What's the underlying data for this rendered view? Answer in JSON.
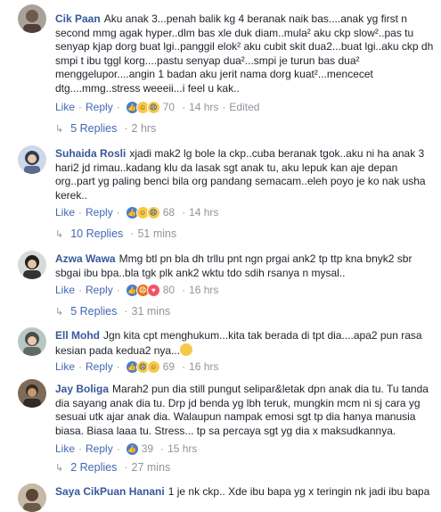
{
  "comments": [
    {
      "name": "Cik Paan",
      "text": "Aku anak 3...penah balik kg 4 beranak naik bas....anak yg first n second mmg agak hyper..dlm bas xle duk diam..mula² aku ckp slow²..pas tu senyap kjap dorg buat lgi..panggil elok² aku cubit skit dua2...buat lgi..aku ckp dh smpi t ibu tggl korg....pastu senyap dua²...smpi je turun bas dua² menggelupor....angin 1 badan aku jerit nama dorg kuat²...mencecet dtg....mmg..stress weeeii...i feel u kak..",
      "like": "Like",
      "reply": "Reply",
      "count": "70",
      "time": "14 hrs",
      "edited": "Edited",
      "replies": "5 Replies",
      "replies_time": "2 hrs"
    },
    {
      "name": "Suhaida Rosli",
      "text": "xjadi mak2 lg bole la ckp..cuba beranak tgok..aku ni ha anak 3 hari2 jd rimau..kadang klu da lasak sgt anak tu, aku lepuk kan aje depan org..part yg paling benci bila org pandang semacam..eleh poyo je ko nak usha kerek..",
      "like": "Like",
      "reply": "Reply",
      "count": "68",
      "time": "14 hrs",
      "replies": "10 Replies",
      "replies_time": "51 mins"
    },
    {
      "name": "Azwa Wawa",
      "text": "Mmg btl pn bla dh trllu pnt ngn prgai ank2 tp ttp kna bnyk2 sbr sbgai ibu bpa..bla tgk plk ank2 wktu tdo sdih rsanya n mysal..",
      "like": "Like",
      "reply": "Reply",
      "count": "80",
      "time": "16 hrs",
      "replies": "5 Replies",
      "replies_time": "31 mins"
    },
    {
      "name": "Ell Mohd",
      "text": "Jgn kita cpt menghukum...kita tak berada di tpt dia....apa2 pun rasa kesian pada kedua2 nya...",
      "like": "Like",
      "reply": "Reply",
      "count": "69",
      "time": "16 hrs"
    },
    {
      "name": "Jay Boliga",
      "text": "Marah2 pun dia still pungut selipar&letak dpn anak dia tu. Tu tanda dia sayang anak dia tu. Drp jd benda yg lbh teruk, mungkin mcm ni sj cara yg sesuai utk ajar anak dia. Walaupun nampak emosi sgt tp dia hanya manusia biasa. Biasa laaa tu. Stress... tp sa percaya sgt yg dia x maksudkannya.",
      "like": "Like",
      "reply": "Reply",
      "count": "39",
      "time": "15 hrs",
      "replies": "2 Replies",
      "replies_time": "27 mins"
    },
    {
      "name": "Saya CikPuan Hanani",
      "text": "1 je nk ckp.. Xde ibu bapa yg x teringin nk jadi ibu bapa"
    }
  ],
  "colors": {
    "name": "#365899",
    "link": "#4267b2",
    "meta": "#90949c",
    "text": "#1d2129"
  }
}
